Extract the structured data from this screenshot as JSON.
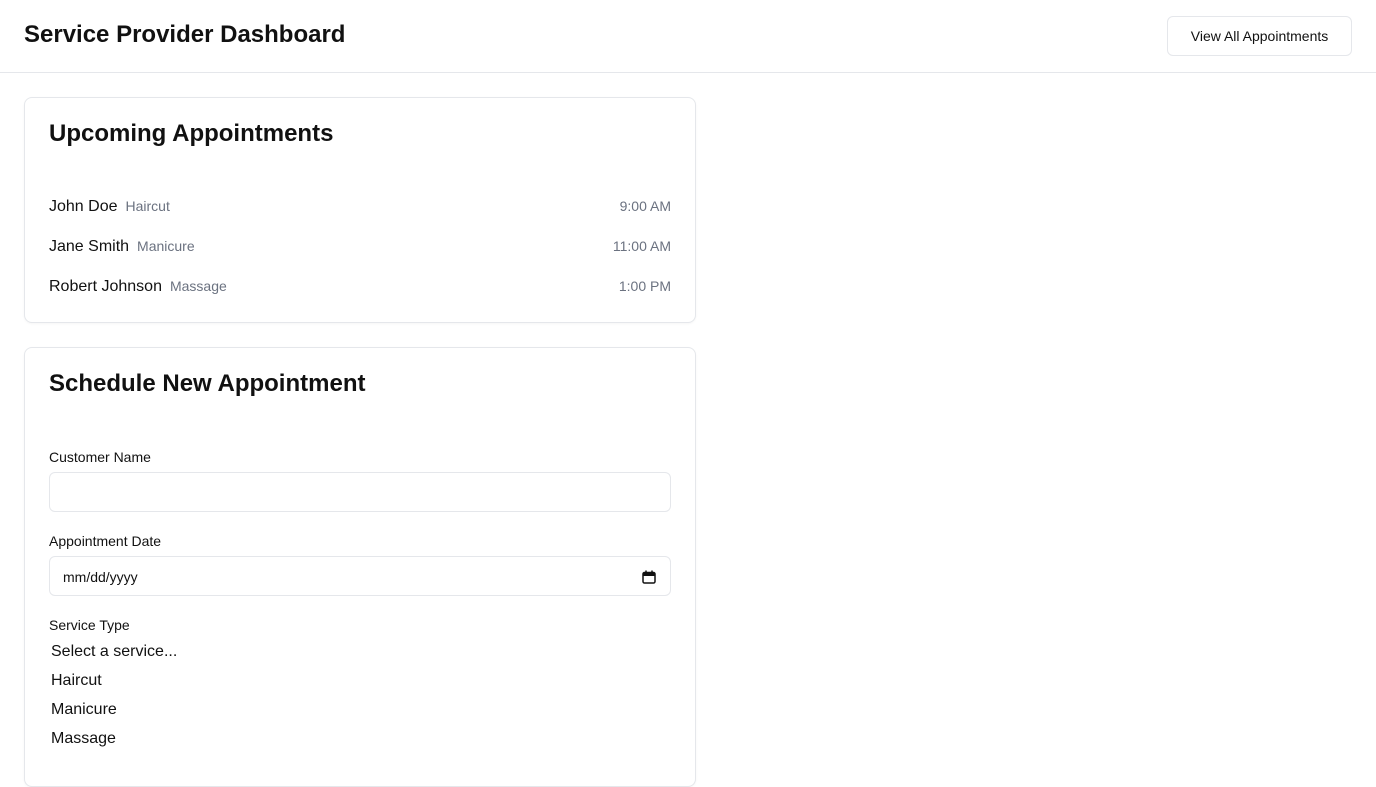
{
  "header": {
    "title": "Service Provider Dashboard",
    "view_all_label": "View All Appointments"
  },
  "upcoming": {
    "title": "Upcoming Appointments",
    "appointments": [
      {
        "name": "John Doe",
        "service": "Haircut",
        "time": "9:00 AM"
      },
      {
        "name": "Jane Smith",
        "service": "Manicure",
        "time": "11:00 AM"
      },
      {
        "name": "Robert Johnson",
        "service": "Massage",
        "time": "1:00 PM"
      }
    ]
  },
  "schedule": {
    "title": "Schedule New Appointment",
    "customer_name_label": "Customer Name",
    "customer_name_value": "",
    "date_label": "Appointment Date",
    "date_placeholder": "mm/dd/yyyy",
    "service_label": "Service Type",
    "service_options": [
      "Select a service...",
      "Haircut",
      "Manicure",
      "Massage"
    ]
  },
  "icons": {
    "calendar": "calendar-icon"
  },
  "colors": {
    "border": "#e5e7eb",
    "muted_text": "#6b7280",
    "text": "#111111"
  }
}
